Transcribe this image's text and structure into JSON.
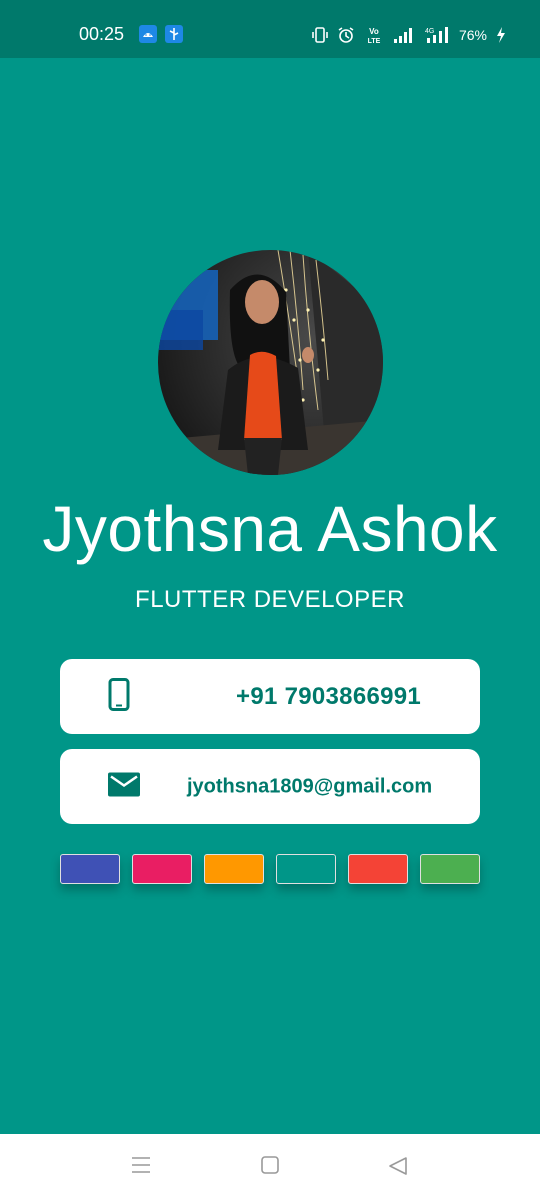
{
  "status_bar": {
    "time": "00:25",
    "battery": "76%",
    "network_label": "4G",
    "volte_label": "Vo LTE",
    "background_color": "#00796b"
  },
  "profile": {
    "name": "Jyothsna Ashok",
    "title": "FLUTTER DEVELOPER",
    "avatar_icon": "profile-photo"
  },
  "contacts": {
    "phone": {
      "icon": "mobile-phone-icon",
      "value": "+91 7903866991"
    },
    "email": {
      "icon": "mail-icon",
      "value": "jyothsna1809@gmail.com"
    }
  },
  "theme_swatches": [
    "#3f51b5",
    "#e91e63",
    "#ff9800",
    "#009688",
    "#f44336",
    "#4caf50"
  ],
  "colors": {
    "background": "#009688",
    "accent_text": "#00796b",
    "card": "#ffffff"
  },
  "nav_bar": {
    "buttons": [
      "menu-icon",
      "home-square-icon",
      "back-triangle-icon"
    ]
  }
}
